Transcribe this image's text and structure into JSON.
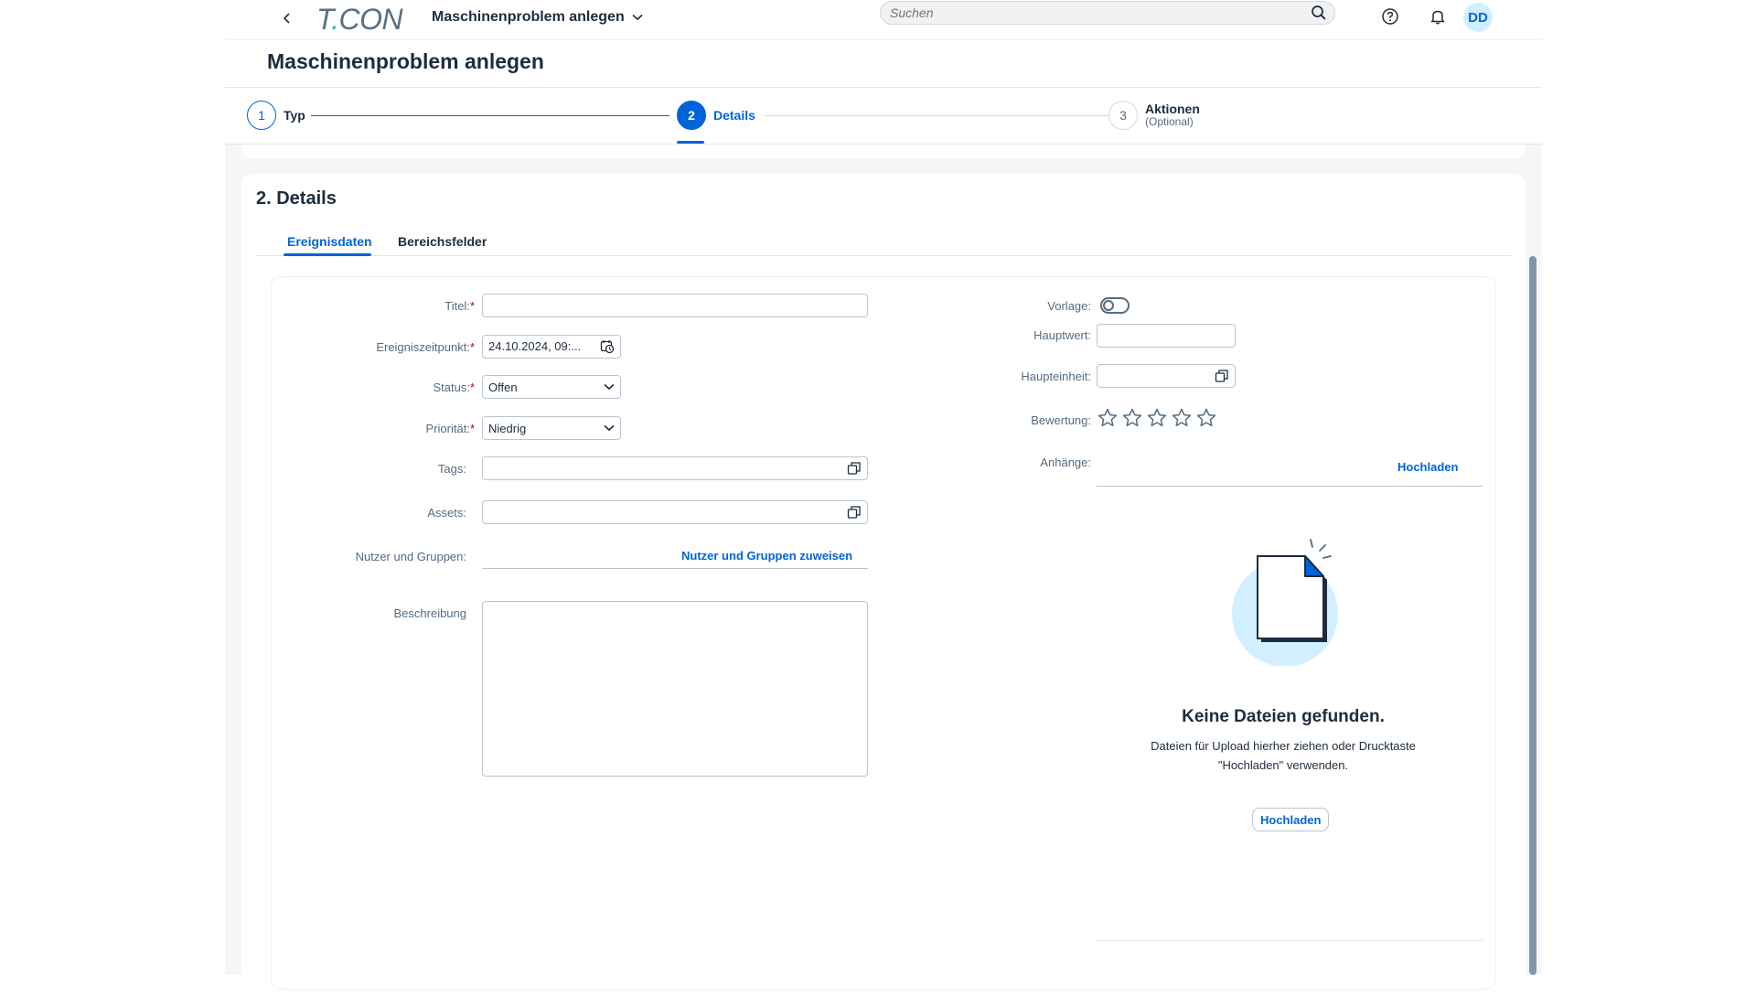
{
  "shell": {
    "logo_prefix": "T",
    "logo_dot": ".",
    "logo_suffix": "CON",
    "title": "Maschinenproblem anlegen",
    "search_placeholder": "Suchen",
    "avatar_initials": "DD"
  },
  "page": {
    "title": "Maschinenproblem anlegen"
  },
  "wizard": {
    "steps": [
      {
        "number": "1",
        "label": "Typ",
        "sub": ""
      },
      {
        "number": "2",
        "label": "Details",
        "sub": ""
      },
      {
        "number": "3",
        "label": "Aktionen",
        "sub": "(Optional)"
      }
    ]
  },
  "section": {
    "title": "2. Details",
    "tabs": [
      {
        "label": "Ereignisdaten"
      },
      {
        "label": "Bereichsfelder"
      }
    ]
  },
  "form": {
    "titel_label": "Titel:",
    "titel_value": "",
    "ereigniszeitpunkt_label": "Ereigniszeitpunkt:",
    "ereigniszeitpunkt_value": "24.10.2024, 09:...",
    "status_label": "Status:",
    "status_value": "Offen",
    "prioritaet_label": "Priorität:",
    "prioritaet_value": "Niedrig",
    "tags_label": "Tags:",
    "assets_label": "Assets:",
    "nutzer_label": "Nutzer und Gruppen:",
    "nutzer_link": "Nutzer und Gruppen zuweisen",
    "beschreibung_label": "Beschreibung",
    "required_mark": "*"
  },
  "right_form": {
    "vorlage_label": "Vorlage:",
    "vorlage_on": false,
    "hauptwert_label": "Hauptwert:",
    "haupteinheit_label": "Haupteinheit:",
    "bewertung_label": "Bewertung:",
    "bewertung_value": 0,
    "bewertung_max": 5,
    "anhaenge_label": "Anhänge:",
    "upload_link": "Hochladen"
  },
  "empty_state": {
    "title": "Keine Dateien gefunden.",
    "text_line1": "Dateien für Upload hierher ziehen oder Drucktaste",
    "text_line2": "\"Hochladen\" verwenden.",
    "button": "Hochladen"
  },
  "colors": {
    "accent": "#0064d9",
    "required": "#aa0808",
    "text": "#1d2d3e",
    "muted": "#556b82"
  }
}
